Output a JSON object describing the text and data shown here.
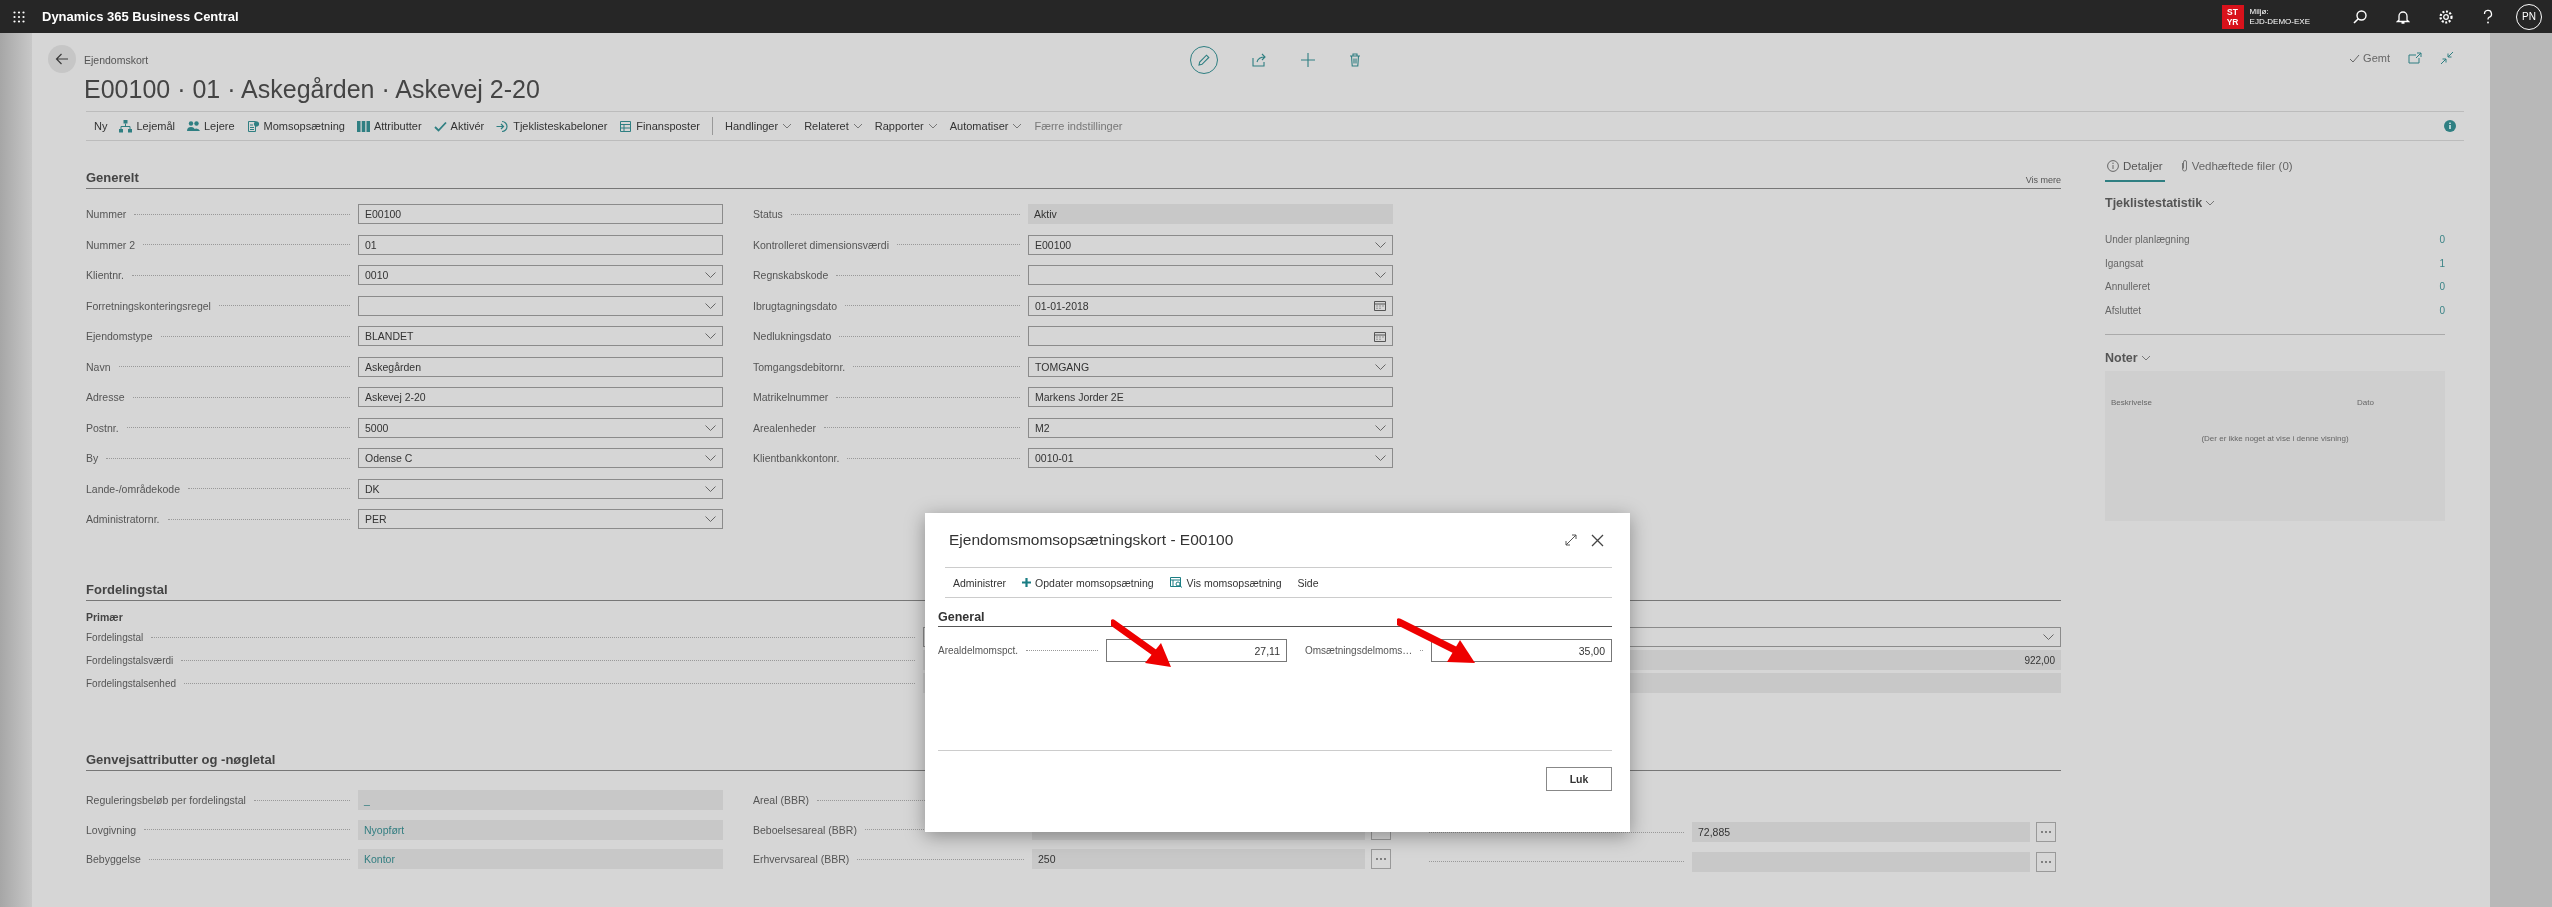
{
  "top_bar": {
    "app_name": "Dynamics 365 Business Central",
    "badge": [
      "ST",
      "YR"
    ],
    "env_label": "Miljø:",
    "env_name": "EJD-DEMO-EXE",
    "avatar": "PN"
  },
  "page": {
    "breadcrumb": "Ejendomskort",
    "title": "E00100 · 01 · Askegården · Askevej 2-20",
    "save_status": "Gemt"
  },
  "actions": [
    {
      "label": "Ny",
      "kind": "plain"
    },
    {
      "label": "Lejemål",
      "kind": "icon"
    },
    {
      "label": "Lejere",
      "kind": "icon"
    },
    {
      "label": "Momsopsætning",
      "kind": "icon"
    },
    {
      "label": "Attributter",
      "kind": "icon"
    },
    {
      "label": "Aktivér",
      "kind": "icon"
    },
    {
      "label": "Tjeklisteskabeloner",
      "kind": "icon"
    },
    {
      "label": "Finansposter",
      "kind": "icon"
    },
    {
      "label": "Handlinger",
      "kind": "menu"
    },
    {
      "label": "Relateret",
      "kind": "menu"
    },
    {
      "label": "Rapporter",
      "kind": "menu"
    },
    {
      "label": "Automatiser",
      "kind": "menu"
    },
    {
      "label": "Færre indstillinger",
      "kind": "muted"
    }
  ],
  "general": {
    "title": "Generelt",
    "more": "Vis mere",
    "left": [
      {
        "label": "Nummer",
        "kind": "text",
        "value": "E00100"
      },
      {
        "label": "Nummer 2",
        "kind": "text",
        "value": "01"
      },
      {
        "label": "Klientnr.",
        "kind": "select",
        "value": "0010"
      },
      {
        "label": "Forretningskonteringsregel",
        "kind": "select"
      },
      {
        "label": "Ejendomstype",
        "kind": "select",
        "value": "BLANDET"
      },
      {
        "label": "Navn",
        "kind": "text",
        "value": "Askegården"
      },
      {
        "label": "Adresse",
        "kind": "text",
        "value": "Askevej 2-20"
      },
      {
        "label": "Postnr.",
        "kind": "select",
        "value": "5000"
      },
      {
        "label": "By",
        "kind": "select",
        "value": "Odense C"
      },
      {
        "label": "Lande-/områdekode",
        "kind": "select",
        "value": "DK"
      },
      {
        "label": "Administratornr.",
        "kind": "select",
        "value": "PER"
      }
    ],
    "right": [
      {
        "label": "Status",
        "kind": "readonly",
        "value": "Aktiv"
      },
      {
        "label": "Kontrolleret dimensionsværdi",
        "kind": "select",
        "value": "E00100"
      },
      {
        "label": "Regnskabskode",
        "kind": "select"
      },
      {
        "label": "Ibrugtagningsdato",
        "kind": "date",
        "value": "01-01-2018"
      },
      {
        "label": "Nedlukningsdato",
        "kind": "date"
      },
      {
        "label": "Tomgangsdebitornr.",
        "kind": "select",
        "value": "TOMGANG"
      },
      {
        "label": "Matrikelnummer",
        "kind": "text",
        "value": "Markens Jorder 2E"
      },
      {
        "label": "Arealenheder",
        "kind": "select",
        "value": "M2"
      },
      {
        "label": "Klientbankkontonr.",
        "kind": "select",
        "value": "0010-01"
      }
    ]
  },
  "distribution": {
    "title": "Fordelingstal",
    "subtitle": "Primær",
    "rows": [
      {
        "label": "Fordelingstal",
        "kind": "select"
      },
      {
        "label": "Fordelingstalsværdi",
        "kind": "number",
        "value": "922,00"
      },
      {
        "label": "Fordelingstalsenhed",
        "kind": "readonly"
      }
    ]
  },
  "shortcuts": {
    "title": "Genvejsattributter og -nøgletal",
    "columns": [
      [
        {
          "label": "Reguleringsbeløb per fordelingstal",
          "kind": "link",
          "value": "_",
          "lookup": false
        },
        {
          "label": "Lovgivning",
          "kind": "link",
          "value": "Nyopført",
          "lookup": false
        },
        {
          "label": "Bebyggelse",
          "kind": "link",
          "value": "Kontor",
          "lookup": false
        }
      ],
      [
        {
          "label": "Areal (BBR)",
          "lookup": false
        },
        {
          "label": "Beboelsesareal (BBR)",
          "kind": "readonly",
          "lookup": true
        },
        {
          "label": "Erhvervsareal (BBR)",
          "kind": "readonly",
          "value": "250",
          "lookup": true
        }
      ],
      [
        {
          "kind": "readonly",
          "value": "72,885",
          "lookup": true
        },
        {
          "kind": "readonly",
          "lookup": true
        }
      ]
    ]
  },
  "factbox": {
    "tabs": [
      {
        "label": "Detaljer",
        "selected": true
      },
      {
        "label": "Vedhæftede filer (0)",
        "selected": false
      }
    ],
    "stats": {
      "title": "Tjeklistestatistik",
      "rows": [
        {
          "label": "Under planlægning",
          "value": "0"
        },
        {
          "label": "Igangsat",
          "value": "1"
        },
        {
          "label": "Annulleret",
          "value": "0"
        },
        {
          "label": "Afsluttet",
          "value": "0"
        }
      ]
    },
    "notes": {
      "title": "Noter",
      "columns": [
        "Beskrivelse",
        "Dato"
      ],
      "empty": "(Der er ikke noget at vise i denne visning)"
    }
  },
  "dialog": {
    "title": "Ejendomsmomsopsætningskort - E00100",
    "actions": [
      {
        "label": "Administrer"
      },
      {
        "label": "Opdater momsopsætning"
      },
      {
        "label": "Vis momsopsætning"
      },
      {
        "label": "Side"
      }
    ],
    "section": "General",
    "fields": [
      {
        "label": "Arealdelmomspct.",
        "value": "27,11"
      },
      {
        "label": "Omsætningsdelmoms…",
        "value": "35,00"
      }
    ],
    "close_button": "Luk"
  }
}
